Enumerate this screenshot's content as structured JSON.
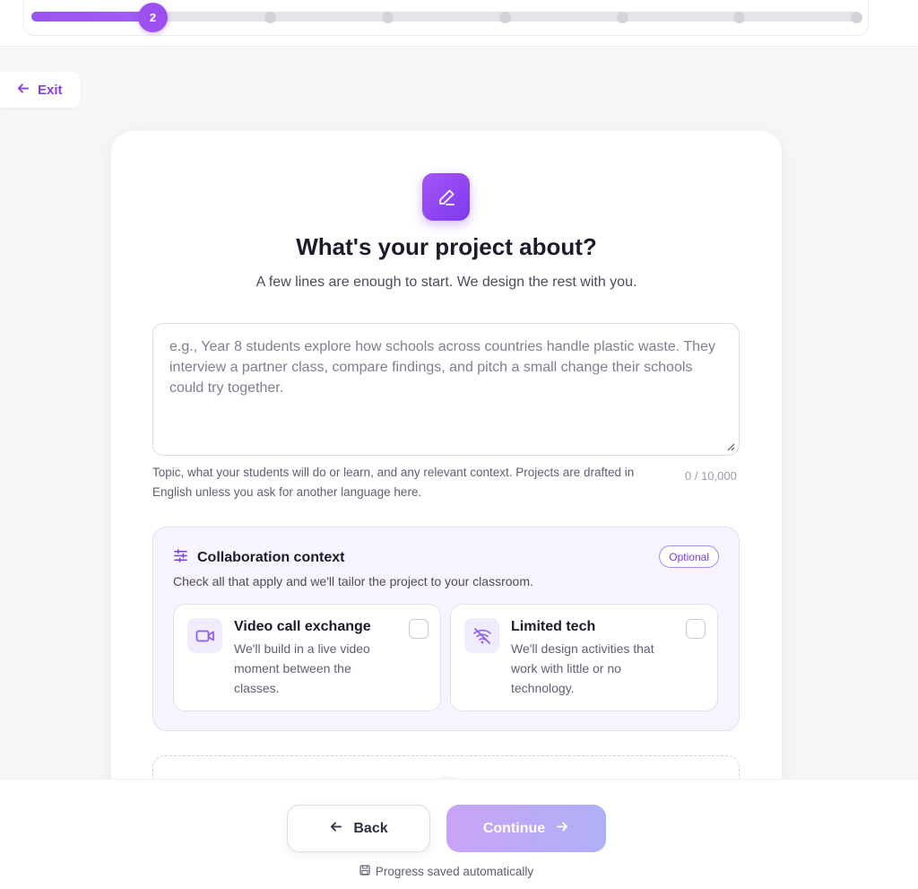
{
  "progress": {
    "current_step": "2",
    "total_steps": 8,
    "fraction_complete": 0.14
  },
  "exit": {
    "label": "Exit"
  },
  "header": {
    "title": "What's your project about?",
    "subtitle": "A few lines are enough to start. We design the rest with you."
  },
  "description": {
    "value": "",
    "placeholder": "e.g., Year 8 students explore how schools across countries handle plastic waste. They interview a partner class, compare findings, and pitch a small change their schools could try together.",
    "hint": "Topic, what your students will do or learn, and any relevant context. Projects are drafted in English unless you ask for another language here.",
    "counter": "0 / 10,000"
  },
  "collaboration": {
    "title": "Collaboration context",
    "badge": "Optional",
    "description": "Check all that apply and we'll tailor the project to your classroom.",
    "options": [
      {
        "title": "Video call exchange",
        "description": "We'll build in a live video moment between the classes.",
        "icon": "video-camera-icon",
        "checked": false
      },
      {
        "title": "Limited tech",
        "description": "We'll design activities that work with little or no technology.",
        "icon": "wifi-off-icon",
        "checked": false
      }
    ]
  },
  "footer": {
    "back_label": "Back",
    "continue_label": "Continue",
    "saved_text": "Progress saved automatically"
  },
  "colors": {
    "accent": "#9d4ff0",
    "accent_dark": "#7c3aed",
    "continue_disabled": "#c9a4f6"
  }
}
